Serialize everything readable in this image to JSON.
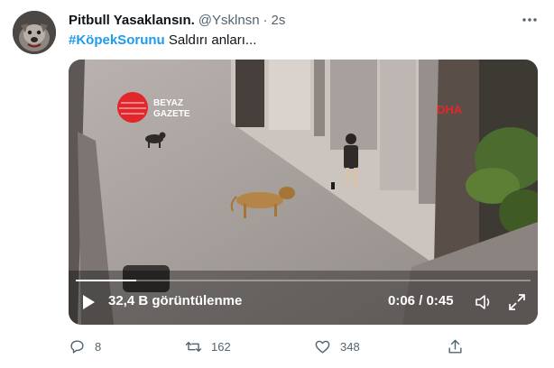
{
  "tweet": {
    "display_name": "Pitbull Yasaklansın.",
    "handle": "@Ysklnsn",
    "separator": "·",
    "time": "2s",
    "hashtag": "#KöpekSorunu",
    "body_text": " Saldırı anları...",
    "avatar_icon": "pitbull-avatar"
  },
  "video": {
    "watermark_left": "BEYAZ GAZETE",
    "watermark_left_line1": "BEYAZ",
    "watermark_left_line2": "GAZETE",
    "watermark_right": "DHA",
    "views_label": "32,4 B görüntülenme",
    "timecode": "0:06 / 0:45",
    "progress_fraction": 0.133,
    "play_icon": "play-icon",
    "volume_icon": "volume-icon",
    "fullscreen_icon": "fullscreen-icon"
  },
  "actions": {
    "reply_count": "8",
    "retweet_count": "162",
    "like_count": "348",
    "reply_icon": "reply-icon",
    "retweet_icon": "retweet-icon",
    "like_icon": "heart-icon",
    "share_icon": "share-icon"
  },
  "colors": {
    "accent": "#1d9bf0",
    "muted": "#536471",
    "watermark_red": "#e3262b"
  }
}
